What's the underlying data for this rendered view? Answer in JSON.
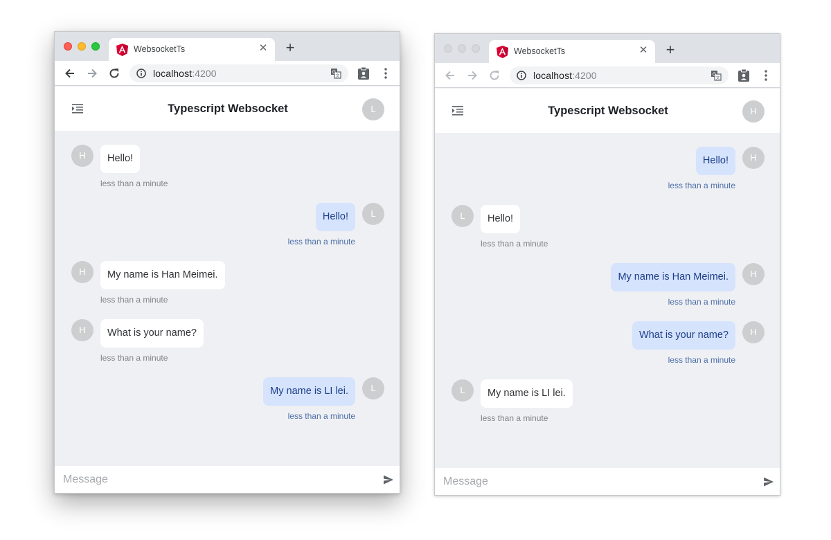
{
  "windows": [
    {
      "id": "left",
      "tab_title": "WebsocketTs",
      "url_host": "localhost",
      "url_port": ":4200",
      "app_title": "Typescript Websocket",
      "header_avatar": "L",
      "composer_placeholder": "Message",
      "messages": [
        {
          "dir": "in",
          "avatar": "H",
          "text": "Hello!",
          "time": "less than a minute"
        },
        {
          "dir": "out",
          "avatar": "L",
          "text": "Hello!",
          "time": "less than a minute"
        },
        {
          "dir": "in",
          "avatar": "H",
          "text": "My name is Han Meimei.",
          "time": "less than a minute"
        },
        {
          "dir": "in",
          "avatar": "H",
          "text": "What is your name?",
          "time": "less than a minute"
        },
        {
          "dir": "out",
          "avatar": "L",
          "text": "My name is LI lei.",
          "time": "less than a minute"
        }
      ]
    },
    {
      "id": "right",
      "tab_title": "WebsocketTs",
      "url_host": "localhost",
      "url_port": ":4200",
      "app_title": "Typescript Websocket",
      "header_avatar": "H",
      "composer_placeholder": "Message",
      "messages": [
        {
          "dir": "out",
          "avatar": "H",
          "text": "Hello!",
          "time": "less than a minute"
        },
        {
          "dir": "in",
          "avatar": "L",
          "text": "Hello!",
          "time": "less than a minute"
        },
        {
          "dir": "out",
          "avatar": "H",
          "text": "My name is Han Meimei.",
          "time": "less than a minute"
        },
        {
          "dir": "out",
          "avatar": "H",
          "text": "What is your name?",
          "time": "less than a minute"
        },
        {
          "dir": "in",
          "avatar": "L",
          "text": "My name is LI lei.",
          "time": "less than a minute"
        }
      ]
    }
  ],
  "colors": {
    "chat_background": "#eff0f3",
    "outgoing_bubble": "#d5e3fd",
    "outgoing_text": "#1d3e88",
    "incoming_bubble": "#ffffff",
    "angular_red": "#dd0031"
  },
  "icons": [
    "angular-logo-icon",
    "close-icon",
    "plus-icon",
    "back-arrow-icon",
    "forward-arrow-icon",
    "reload-icon",
    "info-icon",
    "translate-icon",
    "clipboard-extension-icon",
    "more-vert-icon",
    "menu-list-icon",
    "send-icon"
  ]
}
